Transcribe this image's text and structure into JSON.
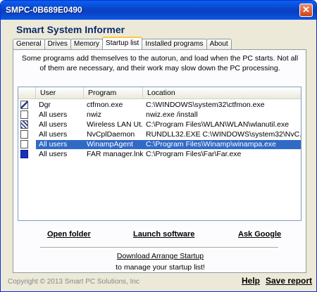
{
  "window": {
    "title": "SMPC-0B689E0490"
  },
  "app": {
    "title": "Smart System Informer"
  },
  "tabs": [
    {
      "label": "General",
      "active": false
    },
    {
      "label": "Drives",
      "active": false
    },
    {
      "label": "Memory",
      "active": false
    },
    {
      "label": "Startup list",
      "active": true
    },
    {
      "label": "Installed programs",
      "active": false
    },
    {
      "label": "About",
      "active": false
    }
  ],
  "startup": {
    "description": "Some programs add themselves to the autorun, and load when the PC starts. Not all of them are necessary, and their work may slow down the PC processing.",
    "columns": {
      "user": "User",
      "program": "Program",
      "location": "Location"
    },
    "rows": [
      {
        "icon": "pen-icon",
        "user": "Dgr",
        "program": "ctfmon.exe",
        "location": "C:\\WINDOWS\\system32\\ctfmon.exe",
        "selected": false
      },
      {
        "icon": "blank-icon",
        "user": "All users",
        "program": "nwiz",
        "location": "nwiz.exe /install",
        "selected": false
      },
      {
        "icon": "network-icon",
        "user": "All users",
        "program": "Wireless LAN Ut...",
        "location": "C:\\Program Files\\WLAN\\WLAN\\wlanutil.exe",
        "selected": false
      },
      {
        "icon": "blank-icon",
        "user": "All users",
        "program": "NvCplDaemon",
        "location": "RUNDLL32.EXE C:\\WINDOWS\\system32\\NvC...",
        "selected": false
      },
      {
        "icon": "blank-icon",
        "user": "All users",
        "program": "WinampAgent",
        "location": "C:\\Program Files\\Winamp\\winampa.exe",
        "selected": true
      },
      {
        "icon": "far-icon",
        "user": "All users",
        "program": "FAR manager.lnk",
        "location": "C:\\Program Files\\Far\\Far.exe",
        "selected": false
      }
    ],
    "actions": {
      "open_folder": "Open folder",
      "launch_software": "Launch software",
      "ask_google": "Ask Google"
    },
    "download_link": "Download Arrange Startup",
    "download_sub": "to manage your startup list!"
  },
  "footer": {
    "copyright": "Copyright © 2013 Smart PC Solutions, Inc",
    "help": "Help",
    "save_report": "Save report"
  },
  "colors": {
    "selection": "#316ac5",
    "titlebar": "#0845c9",
    "tab_highlight": "#ffc83c"
  }
}
